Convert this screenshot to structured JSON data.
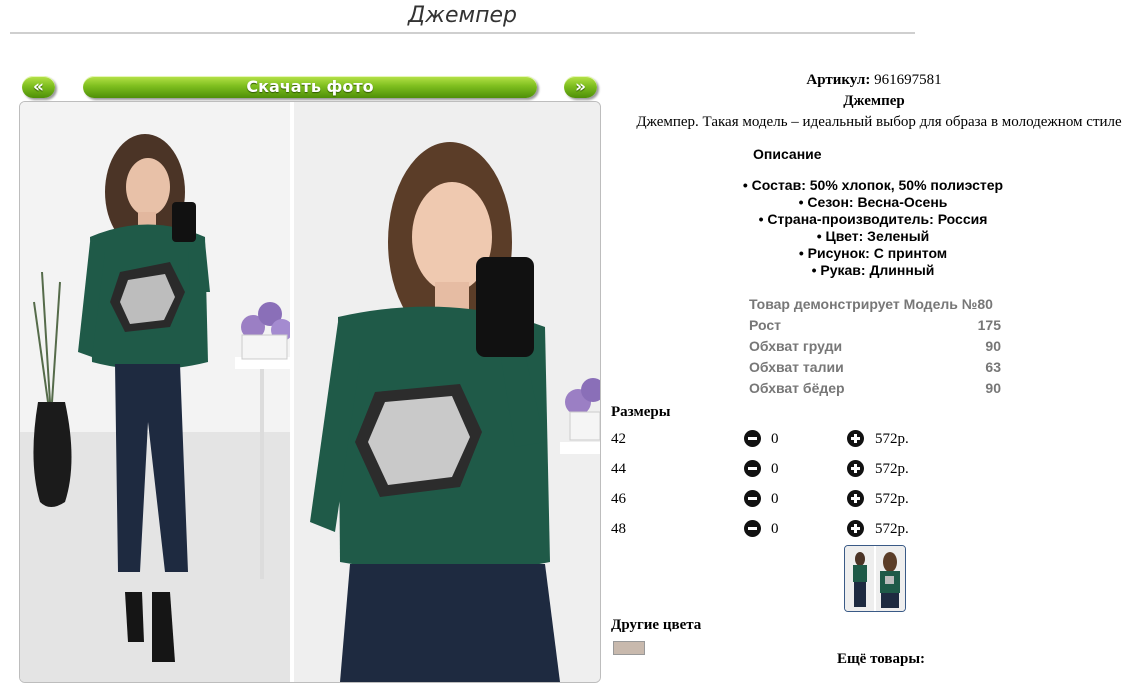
{
  "page": {
    "title": "Джемпер"
  },
  "gallery": {
    "prev_label": "«",
    "download_label": "Скачать фото",
    "next_label": "»"
  },
  "product": {
    "article_label": "Артикул:",
    "article_value": "961697581",
    "name": "Джемпер",
    "short_description": "Джемпер. Такая модель – идеальный выбор для образа в молодежном стиле",
    "description_heading": "Описание",
    "properties": [
      "• Состав: 50% хлопок, 50% полиэстер",
      "• Сезон: Весна-Осень",
      "• Страна-производитель: Россия",
      "• Цвет: Зеленый",
      "• Рисунок: С принтом",
      "• Рукав: Длинный"
    ]
  },
  "model": {
    "rows": [
      {
        "label": "Товар демонстрирует Модель №80",
        "value": ""
      },
      {
        "label": "Рост",
        "value": "175"
      },
      {
        "label": "Обхват груди",
        "value": "90"
      },
      {
        "label": "Обхват талии",
        "value": "63"
      },
      {
        "label": "Обхват бёдер",
        "value": "90"
      }
    ]
  },
  "sizes": {
    "heading": "Размеры",
    "rows": [
      {
        "size": "42",
        "qty": "0",
        "price": "572р."
      },
      {
        "size": "44",
        "qty": "0",
        "price": "572р."
      },
      {
        "size": "46",
        "qty": "0",
        "price": "572р."
      },
      {
        "size": "48",
        "qty": "0",
        "price": "572р."
      }
    ]
  },
  "other_colors": {
    "heading": "Другие цвета"
  },
  "more_goods": {
    "heading": "Ещё товары:"
  },
  "colors": {
    "accent_green": "#7fbf1f",
    "sweater_green": "#1f5a48",
    "jeans_blue": "#1e2a40",
    "muted_text": "#777777"
  }
}
